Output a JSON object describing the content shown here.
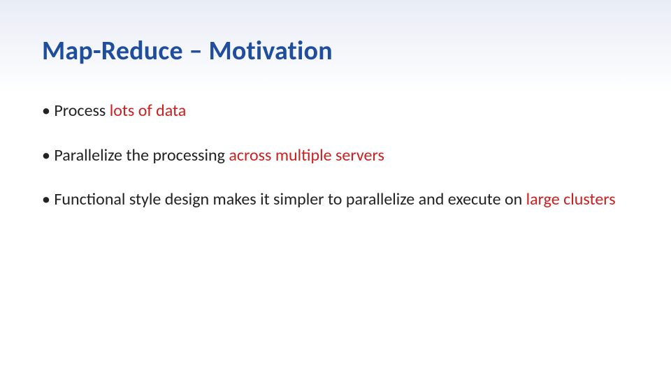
{
  "title": "Map-Reduce – Motivation",
  "bullets": [
    {
      "pre": "Process ",
      "hl": "lots of data",
      "post": ""
    },
    {
      "pre": "Parallelize the processing ",
      "hl": "across multiple servers",
      "post": ""
    },
    {
      "pre": "Functional style design makes it simpler to parallelize and execute on ",
      "hl": "large clusters",
      "post": ""
    }
  ]
}
